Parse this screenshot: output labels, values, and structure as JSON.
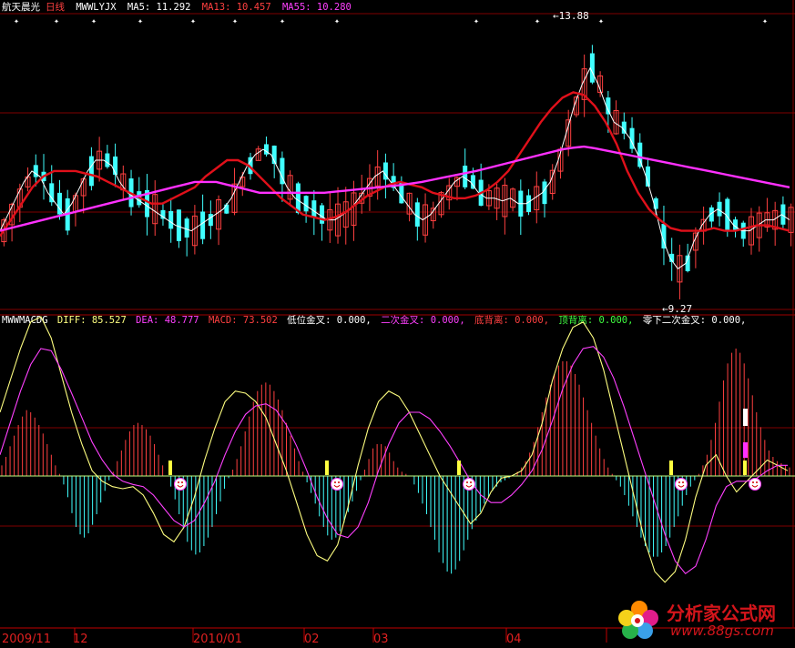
{
  "title_bar": {
    "stock_name": "航天晨光",
    "period": "日线",
    "indicator_name": "MWWLYJX",
    "ma5_label": "MA5: 11.292",
    "ma13_label": "MA13: 10.457",
    "ma55_label": "MA55: 10.280"
  },
  "macd_bar": {
    "indicator_name": "MWWMACDG",
    "diff_label": "DIFF: 85.527",
    "dea_label": "DEA: 48.777",
    "macd_label": "MACD: 73.502",
    "low_cross_label": "低位金叉: 0.000,",
    "second_cross_label": "二次金叉: 0.000,",
    "bottom_div_label": "底背离: 0.000,",
    "top_div_label": "顶背离: 0.000,",
    "below_zero_cross_label": "零下二次金叉: 0.000,"
  },
  "colors": {
    "up": "#ff4040",
    "down": "#40ffff",
    "ma5": "#ffffff",
    "ma13": "#e0101a",
    "ma55": "#ff30ff",
    "diff": "#ffff80",
    "dea": "#ff40ff",
    "grid": "#800000",
    "axis_text": "#e02020"
  },
  "chart_data": [
    {
      "type": "candlestick",
      "ylim": [
        9.27,
        13.88
      ],
      "max_label": "13.88",
      "min_label": "9.27",
      "x": [
        "2009/11",
        "12",
        "2010/01",
        "02",
        "03",
        "04"
      ],
      "series": [
        {
          "name": "MA5",
          "values": [
            10.3,
            10.6,
            10.9,
            11.2,
            11.4,
            11.3,
            11.0,
            10.8,
            10.6,
            10.8,
            11.1,
            11.4,
            11.6,
            11.6,
            11.5,
            11.2,
            11.0,
            10.9,
            10.8,
            10.7,
            10.6,
            10.5,
            10.4,
            10.35,
            10.3,
            10.4,
            10.5,
            10.6,
            10.7,
            10.9,
            11.2,
            11.5,
            11.7,
            11.8,
            11.7,
            11.4,
            11.1,
            10.9,
            10.8,
            10.7,
            10.6,
            10.5,
            10.5,
            10.6,
            10.7,
            10.9,
            11.1,
            11.3,
            11.4,
            11.2,
            11.0,
            10.8,
            10.6,
            10.5,
            10.6,
            10.8,
            11.0,
            11.2,
            11.3,
            11.2,
            11.0,
            10.9,
            10.9,
            10.85,
            10.9,
            10.8,
            10.8,
            10.9,
            11.0,
            11.2,
            11.6,
            12.1,
            12.6,
            13.0,
            13.3,
            13.0,
            12.6,
            12.3,
            12.2,
            12.0,
            11.7,
            11.3,
            10.8,
            10.2,
            9.8,
            9.6,
            9.7,
            10.1,
            10.4,
            10.6,
            10.7,
            10.6,
            10.4,
            10.3,
            10.3,
            10.4,
            10.5,
            10.5,
            10.6,
            10.5
          ]
        },
        {
          "name": "MA13",
          "values": [
            10.2,
            10.5,
            10.8,
            11.1,
            11.3,
            11.4,
            11.4,
            11.4,
            11.35,
            11.3,
            11.2,
            11.1,
            11.0,
            10.9,
            10.8,
            10.8,
            10.9,
            11.0,
            11.1,
            11.3,
            11.45,
            11.6,
            11.6,
            11.5,
            11.3,
            11.1,
            10.9,
            10.75,
            10.6,
            10.55,
            10.5,
            10.55,
            10.65,
            10.8,
            10.95,
            11.05,
            11.15,
            11.2,
            11.15,
            11.1,
            11.0,
            10.95,
            10.9,
            10.9,
            10.95,
            11.05,
            11.2,
            11.4,
            11.7,
            12.0,
            12.3,
            12.55,
            12.75,
            12.85,
            12.8,
            12.6,
            12.3,
            11.9,
            11.4,
            11.0,
            10.7,
            10.5,
            10.35,
            10.3,
            10.3,
            10.3,
            10.35,
            10.3,
            10.3,
            10.35,
            10.4,
            10.4,
            10.35,
            10.3
          ]
        },
        {
          "name": "MA55",
          "values": [
            10.3,
            10.35,
            10.4,
            10.45,
            10.5,
            10.55,
            10.6,
            10.65,
            10.7,
            10.75,
            10.8,
            10.85,
            10.9,
            10.95,
            11.0,
            11.05,
            11.1,
            11.15,
            11.2,
            11.2,
            11.2,
            11.15,
            11.1,
            11.05,
            11.0,
            11.0,
            11.0,
            11.0,
            11.0,
            11.0,
            11.0,
            11.02,
            11.04,
            11.06,
            11.08,
            11.1,
            11.12,
            11.14,
            11.17,
            11.2,
            11.24,
            11.28,
            11.32,
            11.36,
            11.4,
            11.45,
            11.5,
            11.55,
            11.6,
            11.65,
            11.7,
            11.75,
            11.8,
            11.83,
            11.85,
            11.82,
            11.78,
            11.74,
            11.7,
            11.66,
            11.62,
            11.58,
            11.54,
            11.5,
            11.46,
            11.42,
            11.38,
            11.34,
            11.3,
            11.26,
            11.22,
            11.18,
            11.14,
            11.1
          ]
        }
      ]
    },
    {
      "type": "bar",
      "zero_line": 0,
      "ylim": [
        -100,
        120
      ],
      "series": [
        {
          "name": "MACD",
          "values": [
            10,
            18,
            28,
            38,
            48,
            56,
            62,
            60,
            55,
            48,
            40,
            30,
            20,
            10,
            2,
            -8,
            -20,
            -35,
            -48,
            -55,
            -58,
            -54,
            -46,
            -36,
            -25,
            -14,
            -4,
            4,
            14,
            24,
            34,
            42,
            48,
            50,
            48,
            44,
            38,
            30,
            20,
            10,
            0,
            -10,
            -22,
            -36,
            -50,
            -62,
            -70,
            -74,
            -72,
            -66,
            -58,
            -48,
            -36,
            -24,
            -12,
            -2,
            6,
            16,
            28,
            42,
            56,
            70,
            80,
            86,
            88,
            86,
            80,
            72,
            62,
            50,
            38,
            26,
            14,
            4,
            -6,
            -16,
            -26,
            -38,
            -48,
            -56,
            -60,
            -58,
            -52,
            -44,
            -34,
            -24,
            -14,
            -4,
            6,
            16,
            26,
            30,
            30,
            28,
            22,
            14,
            8,
            4,
            2,
            0,
            -8,
            -16,
            -26,
            -36,
            -48,
            -60,
            -72,
            -82,
            -90,
            -92,
            -88,
            -80,
            -70,
            -60,
            -50,
            -42,
            -34,
            -26,
            -20,
            -14,
            -10,
            -6,
            -4,
            -2,
            0,
            4,
            8,
            14,
            22,
            32,
            46,
            60,
            74,
            86,
            96,
            104,
            108,
            108,
            104,
            96,
            86,
            74,
            62,
            50,
            38,
            26,
            16,
            8,
            2,
            -4,
            -10,
            -18,
            -28,
            -38,
            -48,
            -58,
            -66,
            -72,
            -76,
            -76,
            -72,
            -66,
            -58,
            -48,
            -38,
            -28,
            -18,
            -10,
            -4,
            2,
            10,
            20,
            34,
            50,
            70,
            90,
            106,
            116,
            120,
            116,
            106,
            92,
            76,
            60,
            46,
            34,
            24,
            18,
            14,
            12,
            10,
            8
          ]
        },
        {
          "name": "DIFF",
          "values": [
            60,
            90,
            120,
            145,
            150,
            130,
            95,
            60,
            30,
            5,
            -5,
            -10,
            -12,
            -10,
            -18,
            -35,
            -55,
            -62,
            -48,
            -20,
            15,
            45,
            70,
            80,
            78,
            70,
            55,
            30,
            5,
            -25,
            -55,
            -75,
            -80,
            -65,
            -30,
            10,
            45,
            70,
            80,
            75,
            60,
            40,
            20,
            0,
            -15,
            -30,
            -45,
            -35,
            -15,
            -2,
            0,
            5,
            20,
            50,
            90,
            120,
            140,
            145,
            130,
            100,
            60,
            20,
            -20,
            -60,
            -90,
            -100,
            -90,
            -60,
            -20,
            10,
            20,
            0,
            -15,
            -5,
            5,
            15,
            10,
            5
          ]
        },
        {
          "name": "DEA",
          "values": [
            20,
            50,
            80,
            105,
            120,
            118,
            100,
            78,
            55,
            32,
            15,
            2,
            -5,
            -8,
            -10,
            -18,
            -30,
            -42,
            -48,
            -42,
            -25,
            -5,
            20,
            42,
            58,
            66,
            68,
            62,
            48,
            28,
            5,
            -20,
            -40,
            -55,
            -58,
            -48,
            -25,
            5,
            30,
            50,
            60,
            60,
            54,
            42,
            28,
            12,
            -5,
            -18,
            -25,
            -25,
            -18,
            -8,
            5,
            25,
            52,
            82,
            105,
            120,
            122,
            112,
            92,
            65,
            35,
            5,
            -25,
            -55,
            -80,
            -92,
            -85,
            -60,
            -28,
            -10,
            -5,
            -5,
            -2,
            5,
            10,
            10
          ]
        }
      ],
      "signal_markers": [
        185,
        357,
        502,
        735,
        816
      ]
    }
  ]
}
